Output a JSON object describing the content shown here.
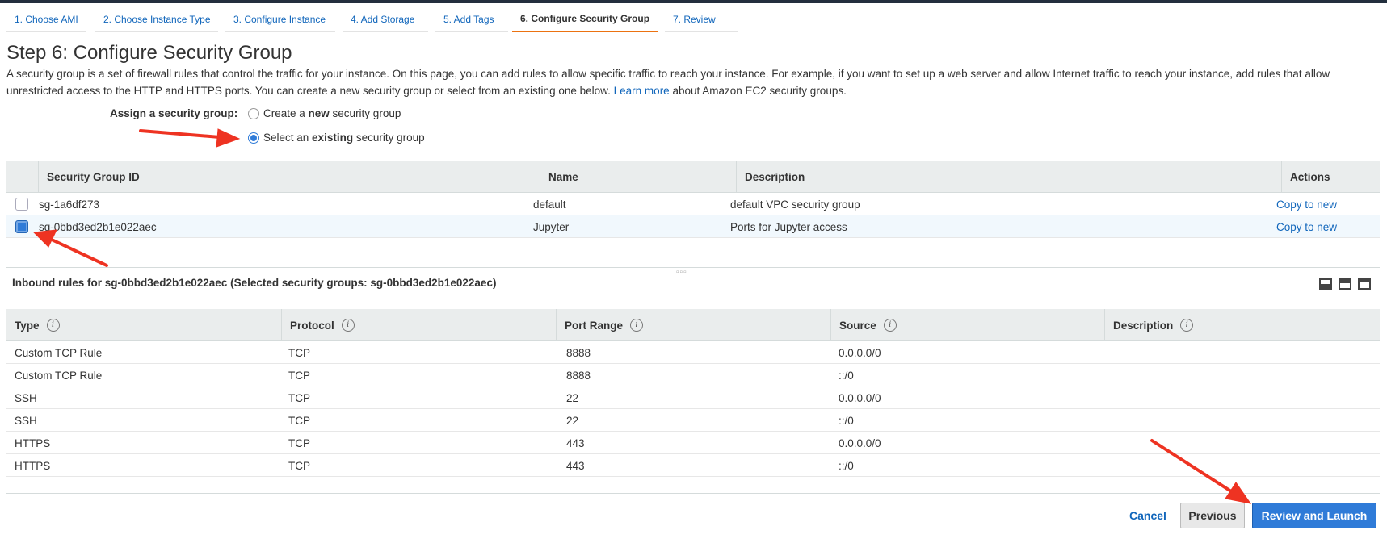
{
  "wizard_tabs": [
    {
      "label": "1. Choose AMI",
      "active": false
    },
    {
      "label": "2. Choose Instance Type",
      "active": false
    },
    {
      "label": "3. Configure Instance",
      "active": false
    },
    {
      "label": "4. Add Storage",
      "active": false
    },
    {
      "label": "5. Add Tags",
      "active": false
    },
    {
      "label": "6. Configure Security Group",
      "active": true
    },
    {
      "label": "7. Review",
      "active": false
    }
  ],
  "page": {
    "title": "Step 6: Configure Security Group",
    "intro_text": "A security group is a set of firewall rules that control the traffic for your instance. On this page, you can add rules to allow specific traffic to reach your instance. For example, if you want to set up a web server and allow Internet traffic to reach your instance, add rules that allow unrestricted access to the HTTP and HTTPS ports. You can create a new security group or select from an existing one below.",
    "learn_more": "Learn more",
    "intro_suffix": "about Amazon EC2 security groups."
  },
  "assign": {
    "label": "Assign a security group:",
    "option_new_prefix": "Create a ",
    "option_new_bold": "new",
    "option_new_suffix": " security group",
    "option_existing_prefix": "Select an ",
    "option_existing_bold": "existing",
    "option_existing_suffix": " security group",
    "selected": "existing"
  },
  "sg_table": {
    "headers": {
      "id": "Security Group ID",
      "name": "Name",
      "description": "Description",
      "actions": "Actions"
    },
    "rows": [
      {
        "id": "sg-1a6df273",
        "name": "default",
        "description": "default VPC security group",
        "action": "Copy to new",
        "checked": false
      },
      {
        "id": "sg-0bbd3ed2b1e022aec",
        "name": "Jupyter",
        "description": "Ports for Jupyter access",
        "action": "Copy to new",
        "checked": true
      }
    ]
  },
  "inbound": {
    "title": "Inbound rules for sg-0bbd3ed2b1e022aec (Selected security groups: sg-0bbd3ed2b1e022aec)",
    "headers": {
      "type": "Type",
      "protocol": "Protocol",
      "port_range": "Port Range",
      "source": "Source",
      "description": "Description"
    },
    "rows": [
      {
        "type": "Custom TCP Rule",
        "protocol": "TCP",
        "port_range": "8888",
        "source": "0.0.0.0/0",
        "description": ""
      },
      {
        "type": "Custom TCP Rule",
        "protocol": "TCP",
        "port_range": "8888",
        "source": "::/0",
        "description": ""
      },
      {
        "type": "SSH",
        "protocol": "TCP",
        "port_range": "22",
        "source": "0.0.0.0/0",
        "description": ""
      },
      {
        "type": "SSH",
        "protocol": "TCP",
        "port_range": "22",
        "source": "::/0",
        "description": ""
      },
      {
        "type": "HTTPS",
        "protocol": "TCP",
        "port_range": "443",
        "source": "0.0.0.0/0",
        "description": ""
      },
      {
        "type": "HTTPS",
        "protocol": "TCP",
        "port_range": "443",
        "source": "::/0",
        "description": ""
      }
    ]
  },
  "footer": {
    "cancel": "Cancel",
    "previous": "Previous",
    "review_launch": "Review and Launch"
  },
  "info_glyph": "i",
  "colors": {
    "accent_blue": "#2f7bd8",
    "link_blue": "#1166bb",
    "tab_active_underline": "#ec7211",
    "annotation_arrow": "#ee3322"
  }
}
